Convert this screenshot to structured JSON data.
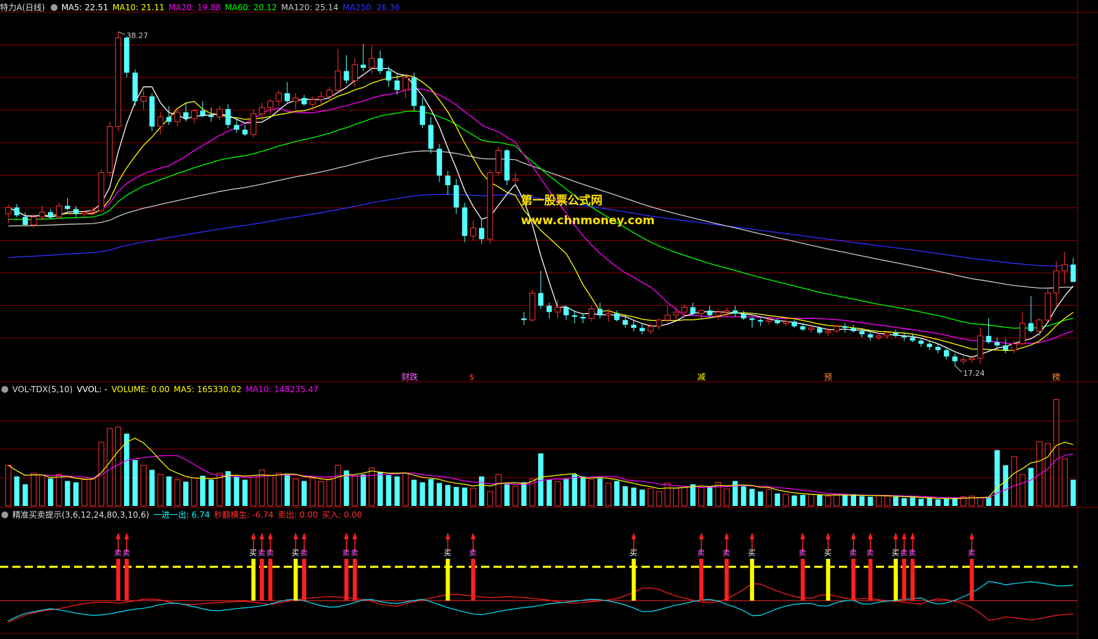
{
  "main_header": {
    "title": "特力A(日线)",
    "items": [
      {
        "label": "MA5: 22.51",
        "color": "#ffffff"
      },
      {
        "label": "MA10: 21.11",
        "color": "#ffff00"
      },
      {
        "label": "MA20: 19.88",
        "color": "#ff00ff"
      },
      {
        "label": "MA60: 20.12",
        "color": "#00ff00"
      },
      {
        "label": "MA120: 25.14",
        "color": "#c8c8c8"
      },
      {
        "label": "MA250: 26.36",
        "color": "#3030ff"
      }
    ]
  },
  "vol_header": {
    "title": "VOL-TDX(5,10)",
    "items": [
      {
        "label": "VVOL: -",
        "color": "#ffffff"
      },
      {
        "label": "VOLUME: 0.00",
        "color": "#ffff00"
      },
      {
        "label": "MA5: 165330.02",
        "color": "#ffff00"
      },
      {
        "label": "MA10: 148235.47",
        "color": "#ff00ff"
      }
    ]
  },
  "ind_header": {
    "title": "精准买卖提示(3,6,12,24,80,3,10,6)",
    "items": [
      {
        "label": "一进一出: 6.74",
        "color": "#00ffff"
      },
      {
        "label": "秒翻横生: -6.74",
        "color": "#ff3030"
      },
      {
        "label": "卖出: 0.00",
        "color": "#ff3030"
      },
      {
        "label": "买入: 0.00",
        "color": "#ff3030"
      }
    ]
  },
  "watermark": {
    "line1": "第一股票公式网",
    "line2": "www.chnmoney.com"
  },
  "colors": {
    "up": "#ff3232",
    "down": "#54ffff",
    "ma5": "#ffffff",
    "ma10": "#ffff00",
    "ma20": "#ff00ff",
    "ma60": "#00ff00",
    "ma120": "#c8c8c8",
    "ma250": "#3030ff",
    "grid": "#8b0000"
  },
  "chart_data": {
    "type": "candlestick",
    "ylim": [
      16.5,
      39.5
    ],
    "high_label": "38.27",
    "low_label": "17.24",
    "candles": [
      [
        26.8,
        27.4,
        26.2,
        27.2
      ],
      [
        27.2,
        27.4,
        26.6,
        26.7
      ],
      [
        26.6,
        26.9,
        26.0,
        26.1
      ],
      [
        26.1,
        26.8,
        25.9,
        26.6
      ],
      [
        26.6,
        27.3,
        26.4,
        26.9
      ],
      [
        26.9,
        27.1,
        26.5,
        26.6
      ],
      [
        26.6,
        27.5,
        26.5,
        27.3
      ],
      [
        27.3,
        27.8,
        27.0,
        27.1
      ],
      [
        27.1,
        27.3,
        26.6,
        26.8
      ],
      [
        26.8,
        27.0,
        26.6,
        26.9
      ],
      [
        26.9,
        27.2,
        26.7,
        27.0
      ],
      [
        27.0,
        29.6,
        26.9,
        29.4
      ],
      [
        29.4,
        32.6,
        29.2,
        32.3
      ],
      [
        32.3,
        38.27,
        32.0,
        37.9
      ],
      [
        37.9,
        38.0,
        35.4,
        35.7
      ],
      [
        35.7,
        35.9,
        33.6,
        33.9
      ],
      [
        33.9,
        34.6,
        33.4,
        34.2
      ],
      [
        34.2,
        34.4,
        32.0,
        32.3
      ],
      [
        32.3,
        33.2,
        31.8,
        32.9
      ],
      [
        32.9,
        33.6,
        32.4,
        32.6
      ],
      [
        32.6,
        33.4,
        32.3,
        33.2
      ],
      [
        33.2,
        33.8,
        32.6,
        32.8
      ],
      [
        32.8,
        33.4,
        32.5,
        33.3
      ],
      [
        33.3,
        33.9,
        32.9,
        33.0
      ],
      [
        33.0,
        33.5,
        32.6,
        32.9
      ],
      [
        32.9,
        33.6,
        32.7,
        33.4
      ],
      [
        33.4,
        33.7,
        32.2,
        32.4
      ],
      [
        32.4,
        32.8,
        31.9,
        32.1
      ],
      [
        32.1,
        32.4,
        31.7,
        31.8
      ],
      [
        31.8,
        33.4,
        31.6,
        33.1
      ],
      [
        33.1,
        33.8,
        32.7,
        33.5
      ],
      [
        33.5,
        34.0,
        33.1,
        33.9
      ],
      [
        33.9,
        34.6,
        33.6,
        34.4
      ],
      [
        34.4,
        35.1,
        33.8,
        33.9
      ],
      [
        33.9,
        34.4,
        33.4,
        34.1
      ],
      [
        34.1,
        34.3,
        33.6,
        33.7
      ],
      [
        33.7,
        34.2,
        33.3,
        34.0
      ],
      [
        34.0,
        34.5,
        33.6,
        34.2
      ],
      [
        34.2,
        34.8,
        33.9,
        34.6
      ],
      [
        34.6,
        37.2,
        34.4,
        35.8
      ],
      [
        35.8,
        36.8,
        35.0,
        35.2
      ],
      [
        35.2,
        36.6,
        34.8,
        36.2
      ],
      [
        36.2,
        37.5,
        35.8,
        36.0
      ],
      [
        36.0,
        37.4,
        35.6,
        36.6
      ],
      [
        36.6,
        37.1,
        35.6,
        35.8
      ],
      [
        35.8,
        36.1,
        34.8,
        35.2
      ],
      [
        35.2,
        35.6,
        34.3,
        34.6
      ],
      [
        34.6,
        35.6,
        34.1,
        35.4
      ],
      [
        35.4,
        35.7,
        33.3,
        33.6
      ],
      [
        33.6,
        34.1,
        32.2,
        32.4
      ],
      [
        32.4,
        32.9,
        30.6,
        30.9
      ],
      [
        30.9,
        31.2,
        28.8,
        29.2
      ],
      [
        29.2,
        29.5,
        28.0,
        28.6
      ],
      [
        28.6,
        29.0,
        26.8,
        27.2
      ],
      [
        27.2,
        27.5,
        25.0,
        25.4
      ],
      [
        25.4,
        26.4,
        25.1,
        25.9
      ],
      [
        25.9,
        26.5,
        24.9,
        25.2
      ],
      [
        25.2,
        29.6,
        24.9,
        29.4
      ],
      [
        29.4,
        31.0,
        29.2,
        30.8
      ],
      [
        30.8,
        30.9,
        28.6,
        28.9
      ],
      [
        28.9,
        29.4,
        28.5,
        29.0
      ],
      [
        20.2,
        20.6,
        19.8,
        20.1
      ],
      [
        20.1,
        22.0,
        20.0,
        21.8
      ],
      [
        21.8,
        23.2,
        20.8,
        21.0
      ],
      [
        21.0,
        21.2,
        20.2,
        20.6
      ],
      [
        20.6,
        21.4,
        20.2,
        20.9
      ],
      [
        20.9,
        21.0,
        20.1,
        20.4
      ],
      [
        20.4,
        20.7,
        19.9,
        20.3
      ],
      [
        20.3,
        20.5,
        19.9,
        20.2
      ],
      [
        20.2,
        21.0,
        20.0,
        20.8
      ],
      [
        20.8,
        21.2,
        20.2,
        20.4
      ],
      [
        20.4,
        20.8,
        20.0,
        20.5
      ],
      [
        20.5,
        20.7,
        20.0,
        20.1
      ],
      [
        20.1,
        20.4,
        19.6,
        19.8
      ],
      [
        19.8,
        20.1,
        19.4,
        19.6
      ],
      [
        19.6,
        19.9,
        19.2,
        19.4
      ],
      [
        19.4,
        19.9,
        19.2,
        19.7
      ],
      [
        19.7,
        20.2,
        19.5,
        20.1
      ],
      [
        20.1,
        21.0,
        19.9,
        20.4
      ],
      [
        20.4,
        20.9,
        20.1,
        20.6
      ],
      [
        20.6,
        21.1,
        20.3,
        20.9
      ],
      [
        20.9,
        21.2,
        20.4,
        20.5
      ],
      [
        20.5,
        20.8,
        20.2,
        20.7
      ],
      [
        20.7,
        21.0,
        20.3,
        20.4
      ],
      [
        20.4,
        20.8,
        20.1,
        20.6
      ],
      [
        20.6,
        20.9,
        20.3,
        20.7
      ],
      [
        20.7,
        21.0,
        20.3,
        20.5
      ],
      [
        20.5,
        20.7,
        20.1,
        20.2
      ],
      [
        20.2,
        20.3,
        19.6,
        20.1
      ],
      [
        20.1,
        20.2,
        19.7,
        20.0
      ],
      [
        20.0,
        20.3,
        19.8,
        20.1
      ],
      [
        20.1,
        20.2,
        19.8,
        19.9
      ],
      [
        19.9,
        20.2,
        19.7,
        20.0
      ],
      [
        20.0,
        20.1,
        19.6,
        19.7
      ],
      [
        19.7,
        19.9,
        19.4,
        19.5
      ],
      [
        19.5,
        19.8,
        19.3,
        19.6
      ],
      [
        19.6,
        19.7,
        19.2,
        19.3
      ],
      [
        19.3,
        19.6,
        19.1,
        19.4
      ],
      [
        19.4,
        19.8,
        19.3,
        19.7
      ],
      [
        19.7,
        19.9,
        19.3,
        19.6
      ],
      [
        19.6,
        19.8,
        19.3,
        19.4
      ],
      [
        19.4,
        19.6,
        19.0,
        19.2
      ],
      [
        19.2,
        19.4,
        18.8,
        19.0
      ],
      [
        19.0,
        19.3,
        18.8,
        19.1
      ],
      [
        19.1,
        19.4,
        18.9,
        19.3
      ],
      [
        19.3,
        19.5,
        19.0,
        19.1
      ],
      [
        19.1,
        19.3,
        18.8,
        19.0
      ],
      [
        19.0,
        19.2,
        18.7,
        18.8
      ],
      [
        18.8,
        19.0,
        18.4,
        18.6
      ],
      [
        18.6,
        18.8,
        18.2,
        18.4
      ],
      [
        18.4,
        18.6,
        18.0,
        18.2
      ],
      [
        18.2,
        18.3,
        17.6,
        17.8
      ],
      [
        17.8,
        18.0,
        17.24,
        17.5
      ],
      [
        17.5,
        17.8,
        17.3,
        17.6
      ],
      [
        17.6,
        17.9,
        17.4,
        17.7
      ],
      [
        17.7,
        19.6,
        17.3,
        19.1
      ],
      [
        19.1,
        20.2,
        18.6,
        18.7
      ],
      [
        18.7,
        19.0,
        18.3,
        18.5
      ],
      [
        18.5,
        18.9,
        18.0,
        18.2
      ],
      [
        18.2,
        18.8,
        18.0,
        18.6
      ],
      [
        18.6,
        20.6,
        18.5,
        19.9
      ],
      [
        19.9,
        21.6,
        19.3,
        19.4
      ],
      [
        19.4,
        20.2,
        19.1,
        20.1
      ],
      [
        20.1,
        22.2,
        20.0,
        21.8
      ],
      [
        21.8,
        23.8,
        21.0,
        23.2
      ],
      [
        23.2,
        24.4,
        22.4,
        23.6
      ],
      [
        23.6,
        24.0,
        22.8,
        22.5
      ]
    ],
    "volume": [
      62,
      45,
      33,
      50,
      47,
      42,
      48,
      38,
      36,
      40,
      42,
      97,
      118,
      120,
      110,
      70,
      62,
      55,
      48,
      45,
      40,
      37,
      43,
      46,
      40,
      50,
      53,
      45,
      40,
      44,
      55,
      47,
      50,
      48,
      41,
      38,
      42,
      37,
      41,
      62,
      54,
      45,
      48,
      58,
      52,
      47,
      45,
      50,
      40,
      36,
      41,
      35,
      32,
      29,
      28,
      27,
      45,
      22,
      48,
      33,
      30,
      36,
      41,
      80,
      40,
      37,
      42,
      48,
      45,
      40,
      42,
      35,
      38,
      30,
      28,
      25,
      27,
      22,
      35,
      27,
      30,
      33,
      28,
      30,
      36,
      26,
      38,
      30,
      26,
      22,
      25,
      19,
      18,
      16,
      17,
      18,
      17,
      15,
      17,
      16,
      18,
      15,
      14,
      16,
      15,
      14,
      12,
      13,
      11,
      12,
      10,
      11,
      12,
      14,
      15,
      12,
      14,
      85,
      62,
      75,
      48,
      58,
      98,
      95,
      162,
      72,
      40
    ],
    "vol_ymax": 170,
    "indicator": {
      "cyan_ends": [
        -3,
        -2,
        -1.6,
        -1.2,
        -1.5,
        -1.9,
        -2.2,
        -2.1,
        -1.7,
        -1.3,
        -1.1,
        -0.6,
        -0.3,
        -0.7,
        -1.2,
        -1.6,
        -1.3,
        -1.1,
        -0.9,
        -0.5,
        0.1,
        0.2,
        -0.4,
        -1.0,
        -0.9,
        -0.3,
        0.3,
        -0.2,
        -0.5,
        -0.1,
        0.2,
        -0.5,
        -1.2,
        -1.7,
        -2.2,
        -1.8,
        -1.4,
        -1.1,
        -0.9,
        -0.5,
        -0.3,
        -0.1,
        0.2,
        0.1,
        -0.3,
        -0.9,
        -1.8,
        -1.4,
        -0.8,
        -0.4,
        0.1,
        0.2,
        -0.6,
        -1.3,
        -2.5,
        -1.7,
        -0.9,
        -0.5,
        -0.4,
        -1.0,
        -0.2,
        0.1,
        -0.7,
        -0.2,
        0.0,
        0.2,
        0.4,
        -0.6,
        -0.3,
        0.5,
        1.5,
        3.0,
        2.3,
        2.6,
        2.8,
        2.5,
        2.1,
        2.3
      ],
      "red_ends": [
        -3.2,
        -2.3,
        -1.7,
        -1.4,
        -1.1,
        -0.6,
        -0.3,
        -0.2,
        -0.4,
        -0.1,
        0.3,
        0.1,
        -0.4,
        -0.6,
        -0.5,
        -0.3,
        -0.2,
        -0.1,
        -0.3,
        -0.6,
        -0.2,
        0.2,
        0.4,
        0.6,
        0.5,
        0.3,
        0.1,
        -0.6,
        -0.9,
        -0.3,
        0.1,
        0.6,
        1.0,
        0.8,
        0.6,
        0.4,
        0.6,
        0.5,
        0.3,
        0.1,
        -0.3,
        -0.4,
        -0.2,
        0.0,
        0.3,
        1.0,
        2.0,
        1.7,
        0.8,
        0.3,
        -0.2,
        -0.4,
        0.3,
        1.4,
        2.8,
        1.9,
        1.1,
        0.5,
        0.3,
        1.0,
        0.6,
        0.1,
        0.4,
        0.1,
        -0.1,
        -0.3,
        -0.5,
        0.3,
        0.1,
        -0.4,
        -1.4,
        -3.1,
        -2.4,
        -2.6,
        -2.9,
        -2.5,
        -2.1,
        -2.0
      ],
      "threshold": 5,
      "ymin": -5.5,
      "ymax": 12,
      "signals": [
        {
          "i": 13,
          "type": "卖"
        },
        {
          "i": 14,
          "type": "卖"
        },
        {
          "i": 29,
          "type": "买"
        },
        {
          "i": 30,
          "type": "卖"
        },
        {
          "i": 31,
          "type": "卖"
        },
        {
          "i": 34,
          "type": "买"
        },
        {
          "i": 35,
          "type": "卖"
        },
        {
          "i": 40,
          "type": "卖"
        },
        {
          "i": 41,
          "type": "卖"
        },
        {
          "i": 52,
          "type": "买"
        },
        {
          "i": 55,
          "type": "卖"
        },
        {
          "i": 74,
          "type": "买"
        },
        {
          "i": 82,
          "type": "卖"
        },
        {
          "i": 85,
          "type": "卖"
        },
        {
          "i": 88,
          "type": "买"
        },
        {
          "i": 94,
          "type": "卖"
        },
        {
          "i": 97,
          "type": "买"
        },
        {
          "i": 100,
          "type": "卖"
        },
        {
          "i": 102,
          "type": "卖"
        },
        {
          "i": 105,
          "type": "买"
        },
        {
          "i": 106,
          "type": "卖"
        },
        {
          "i": 107,
          "type": "卖"
        },
        {
          "i": 114,
          "type": "卖"
        }
      ]
    },
    "event_labels": [
      {
        "i": 47,
        "text": "财跌",
        "color": "#ff60ff"
      },
      {
        "i": 55,
        "text": "$",
        "color": "#ff3030"
      },
      {
        "i": 82,
        "text": "减",
        "color": "#ffff00"
      },
      {
        "i": 97,
        "text": "预",
        "color": "#ff9040"
      },
      {
        "i": 124,
        "text": "榜",
        "color": "#ff9040"
      }
    ]
  }
}
